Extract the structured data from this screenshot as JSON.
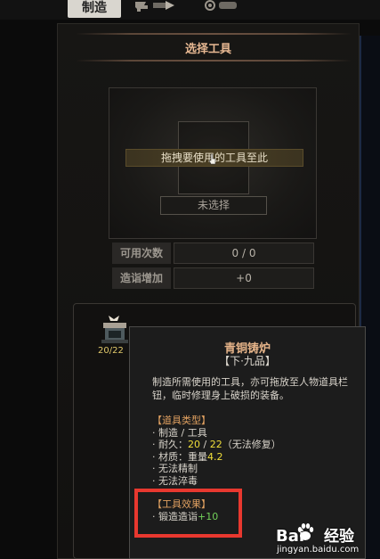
{
  "tabs": {
    "craft": "制造",
    "icons": [
      "anvil-tab-icon",
      "gear-tab-icon"
    ]
  },
  "tool_select": {
    "title": "选择工具",
    "drop_hint": "拖拽要使用的工具至此",
    "select_placeholder": "未选择"
  },
  "stats": [
    {
      "label": "可用次数",
      "value": "0 / 0"
    },
    {
      "label": "造诣增加",
      "value": "+0"
    }
  ],
  "inventory": {
    "item_icon": "bronze-furnace-icon",
    "count": "20/22"
  },
  "tooltip": {
    "name": "青铜铸炉",
    "grade": "【下·九品】",
    "description": "制造所需使用的工具，亦可拖放至人物道具栏钮，临时修理身上破损的装备。",
    "type_header": "【道具类型】",
    "type_value": "· 制造 / 工具",
    "durability_label": "· 耐久：",
    "durability_current": "20",
    "durability_sep": " / ",
    "durability_max": "22",
    "durability_note": "（无法修复）",
    "material_label": "· 材质：重量",
    "material_value": "4.2",
    "no_refine": "· 无法精制",
    "no_poison": "· 无法淬毒",
    "effect_header": "【工具效果】",
    "effect_label": "· 锻造造诣",
    "effect_value": "+10"
  },
  "watermark": {
    "logo_left": "Bai",
    "logo_right": "经验",
    "url": "jingyan.baidu.com"
  },
  "colors": {
    "title_orange": "#e7b892",
    "highlight_yellow": "#f1df3a",
    "highlight_green": "#72cf5a",
    "annotation_red": "#e8382f"
  }
}
